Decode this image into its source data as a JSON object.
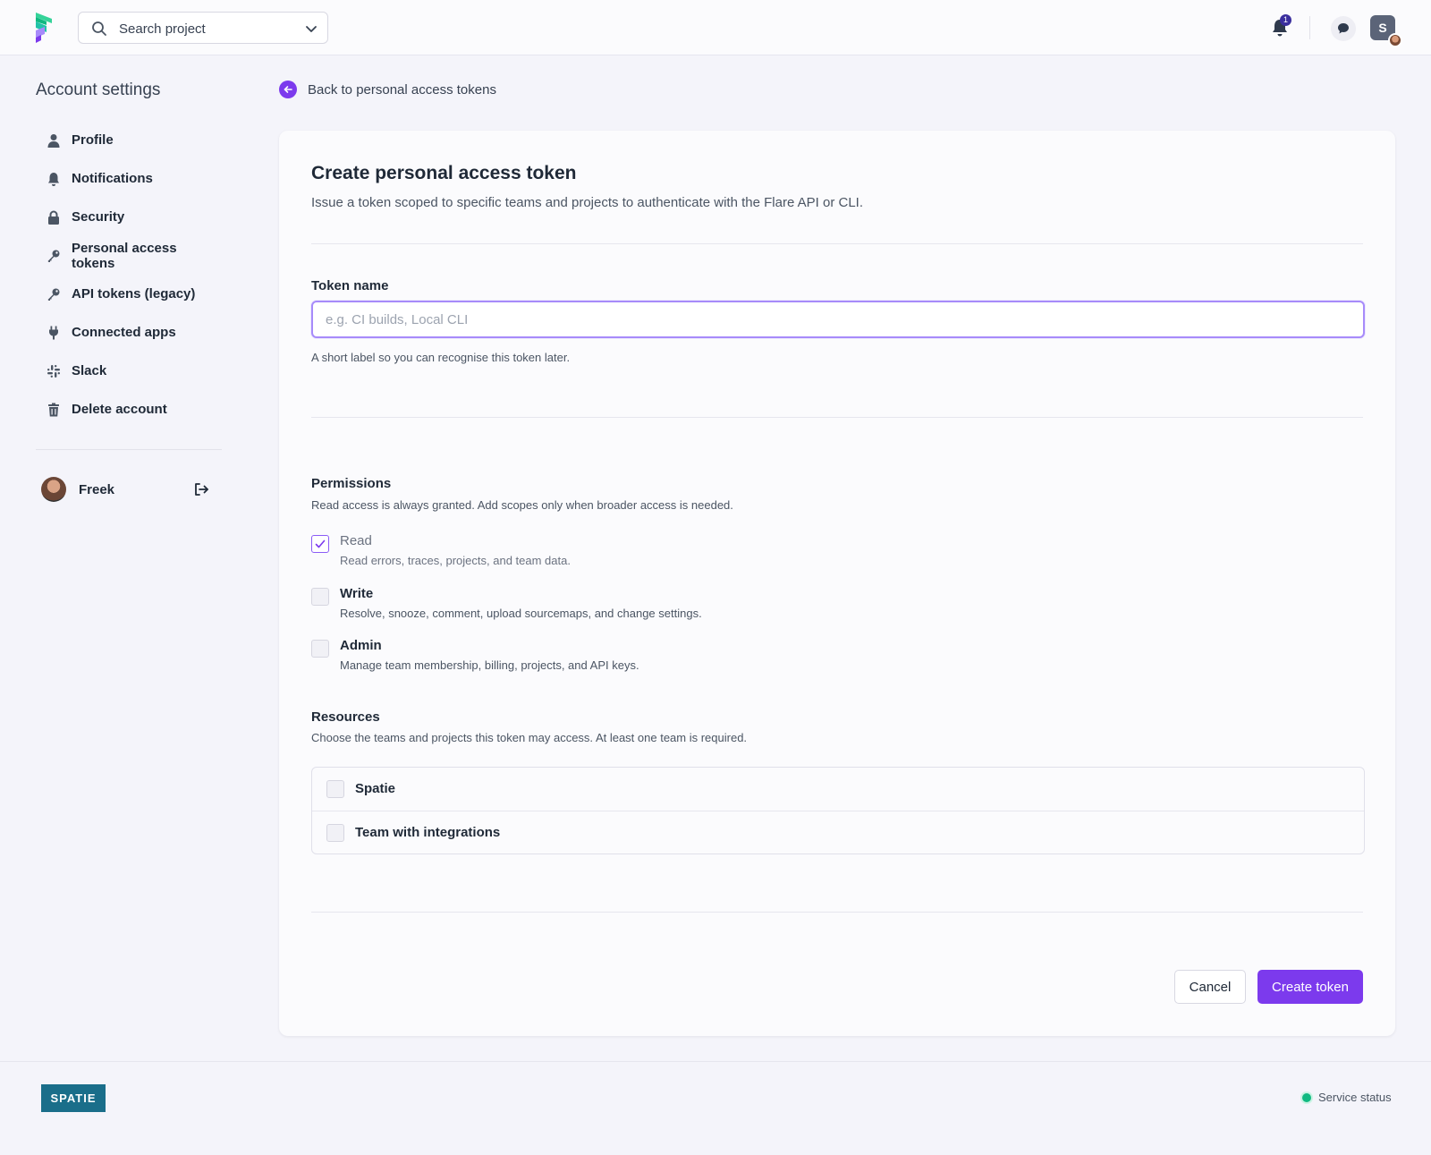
{
  "topbar": {
    "search_label": "Search project",
    "notification_count": "1",
    "user_initial": "S"
  },
  "sidebar": {
    "title": "Account settings",
    "items": [
      {
        "label": "Profile",
        "icon": "user-icon"
      },
      {
        "label": "Notifications",
        "icon": "bell-icon"
      },
      {
        "label": "Security",
        "icon": "lock-icon"
      },
      {
        "label": "Personal access tokens",
        "icon": "key-icon"
      },
      {
        "label": "API tokens (legacy)",
        "icon": "key-icon"
      },
      {
        "label": "Connected apps",
        "icon": "plug-icon"
      },
      {
        "label": "Slack",
        "icon": "slack-icon"
      },
      {
        "label": "Delete account",
        "icon": "trash-icon"
      }
    ],
    "user_name": "Freek"
  },
  "back_link": "Back to personal access tokens",
  "form": {
    "title": "Create personal access token",
    "subtitle": "Issue a token scoped to specific teams and projects to authenticate with the Flare API or CLI.",
    "token_name_label": "Token name",
    "token_name_value": "",
    "token_name_placeholder": "e.g. CI builds, Local CLI",
    "token_name_help": "A short label so you can recognise this token later.",
    "permissions": {
      "heading": "Permissions",
      "description": "Read access is always granted. Add scopes only when broader access is needed.",
      "items": [
        {
          "name": "Read",
          "description": "Read errors, traces, projects, and team data.",
          "checked": true
        },
        {
          "name": "Write",
          "description": "Resolve, snooze, comment, upload sourcemaps, and change settings.",
          "checked": false
        },
        {
          "name": "Admin",
          "description": "Manage team membership, billing, projects, and API keys.",
          "checked": false
        }
      ]
    },
    "resources": {
      "heading": "Resources",
      "description": "Choose the teams and projects this token may access. At least one team is required.",
      "teams": [
        {
          "name": "Spatie",
          "checked": false
        },
        {
          "name": "Team with integrations",
          "checked": false
        }
      ]
    },
    "cancel_label": "Cancel",
    "submit_label": "Create token"
  },
  "footer": {
    "brand": "SPATIE",
    "status_label": "Service status"
  },
  "colors": {
    "accent": "#7c3aed",
    "brand_footer": "#1a6e8a",
    "status_ok": "#10b981"
  }
}
